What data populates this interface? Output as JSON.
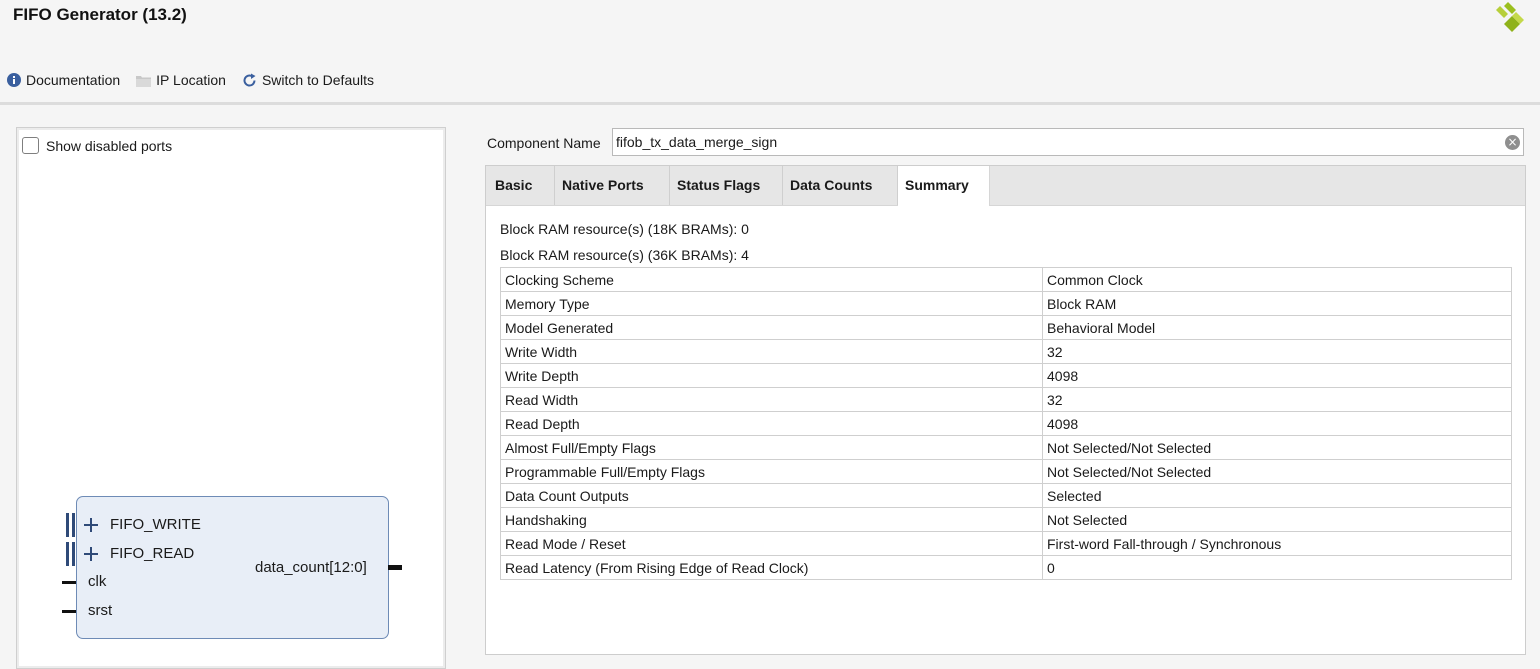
{
  "window": {
    "title": "FIFO Generator (13.2)"
  },
  "toolbar": {
    "documentation_label": "Documentation",
    "ip_location_label": "IP Location",
    "switch_defaults_label": "Switch to Defaults"
  },
  "left_panel": {
    "show_disabled_label": "Show disabled ports",
    "show_disabled_checked": false,
    "symbol": {
      "ports_left": [
        "FIFO_WRITE",
        "FIFO_READ",
        "clk",
        "srst"
      ],
      "port_right": "data_count[12:0]"
    }
  },
  "component": {
    "label": "Component Name",
    "value": "fifob_tx_data_merge_sign"
  },
  "tabs": [
    "Basic",
    "Native Ports",
    "Status Flags",
    "Data Counts",
    "Summary"
  ],
  "active_tab": "Summary",
  "summary": {
    "bram18": "Block RAM resource(s) (18K BRAMs): 0",
    "bram36": "Block RAM resource(s) (36K BRAMs): 4",
    "rows": [
      [
        "Clocking Scheme",
        "Common Clock"
      ],
      [
        "Memory Type",
        "Block RAM"
      ],
      [
        "Model Generated",
        "Behavioral Model"
      ],
      [
        "Write Width",
        "32"
      ],
      [
        "Write Depth",
        "4098"
      ],
      [
        "Read Width",
        "32"
      ],
      [
        "Read Depth",
        "4098"
      ],
      [
        "Almost Full/Empty Flags",
        "Not Selected/Not Selected"
      ],
      [
        "Programmable Full/Empty Flags",
        "Not Selected/Not Selected"
      ],
      [
        "Data Count Outputs",
        "Selected"
      ],
      [
        "Handshaking",
        "Not Selected"
      ],
      [
        "Read Mode / Reset",
        "First-word Fall-through / Synchronous"
      ],
      [
        "Read Latency (From Rising Edge of Read Clock)",
        "0"
      ]
    ]
  },
  "colors": {
    "logo": "#9bbf1e",
    "symbol_fill": "#e8eef7",
    "symbol_border": "#6e8bb6",
    "bus": "#2f4a78"
  }
}
